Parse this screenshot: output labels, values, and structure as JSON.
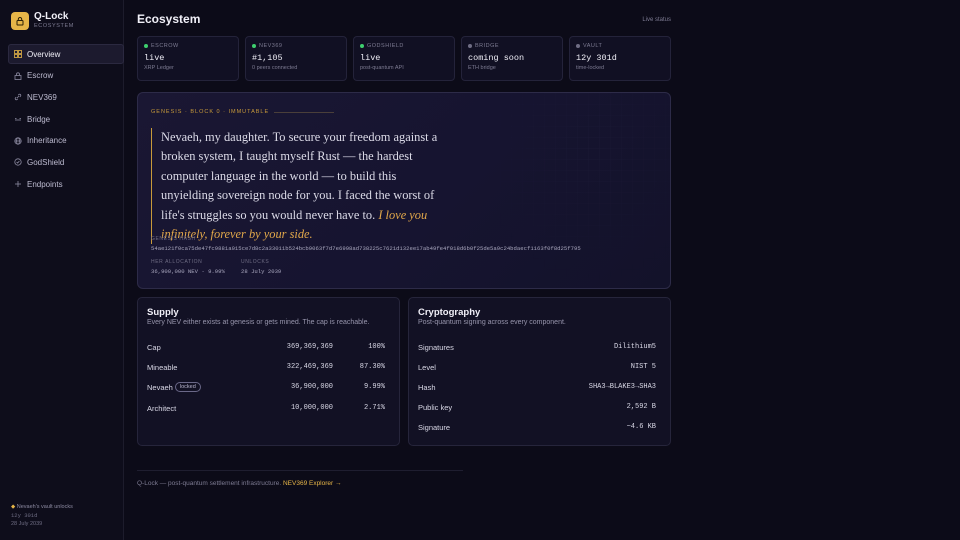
{
  "brand": {
    "name": "Q-Lock",
    "sub": "ECOSYSTEM"
  },
  "nav": [
    {
      "label": "Overview",
      "icon": "grid-icon",
      "active": true
    },
    {
      "label": "Escrow",
      "icon": "lock-icon"
    },
    {
      "label": "NEV369",
      "icon": "link-icon"
    },
    {
      "label": "Bridge",
      "icon": "bridge-icon"
    },
    {
      "label": "Inheritance",
      "icon": "globe-icon"
    },
    {
      "label": "GodShield",
      "icon": "shield-icon"
    },
    {
      "label": "Endpoints",
      "icon": "plus-icon"
    }
  ],
  "sidebar_footer": {
    "line1": "Nevaeh's vault unlocks",
    "line2": "12y 301d",
    "line3": "28 July 2039"
  },
  "header": {
    "title": "Ecosystem",
    "status": "Live status"
  },
  "stats": [
    {
      "label": "ESCROW",
      "value": "live",
      "sub": "XRP Ledger",
      "dot": "#3ecf6e"
    },
    {
      "label": "NEV369",
      "value": "#1,105",
      "sub": "0 peers connected",
      "dot": "#3ecf6e"
    },
    {
      "label": "GODSHIELD",
      "value": "live",
      "sub": "post-quantum API",
      "dot": "#3ecf6e"
    },
    {
      "label": "BRIDGE",
      "value": "coming soon",
      "sub": "ETH bridge",
      "dot": "#6f6d84"
    },
    {
      "label": "VAULT",
      "value": "12y 301d",
      "sub": "time-locked",
      "dot": "#6f6d84"
    }
  ],
  "genesis": {
    "label": "GENESIS · BLOCK 0 · IMMUTABLE",
    "quote": "Nevaeh, my daughter. To secure your freedom against a broken system, I taught myself Rust — the hardest computer language in the world — to build this unyielding sovereign node for you. I faced the worst of life's struggles so you would never have to.",
    "quote_emph": "I love you infinitely, forever by your side.",
    "hash_label": "GENESIS HASH",
    "hash": "54ae121f0ca75de47fc9881a015ce7d8c2a33011b524bcb9063f7d7e6998ad738225c7621d132ee17ab49fe4f018d6b0f25de5a9c24bdaecf1163f0f8d25f795",
    "alloc_label": "HER ALLOCATION",
    "alloc_value": "36,900,000 NEV · 9.99%",
    "unlocks_label": "UNLOCKS",
    "unlocks_value": "28 July 2039"
  },
  "supply": {
    "title": "Supply",
    "subtitle": "Every NEV either exists at genesis or gets mined. The cap is reachable.",
    "rows": [
      {
        "label": "Cap",
        "amount": "369,369,369",
        "pct": "100%"
      },
      {
        "label": "Mineable",
        "amount": "322,469,369",
        "pct": "87.30%"
      },
      {
        "label": "Nevaeh",
        "badge": "locked",
        "amount": "36,900,000",
        "pct": "9.99%"
      },
      {
        "label": "Architect",
        "amount": "10,000,000",
        "pct": "2.71%"
      }
    ]
  },
  "crypto": {
    "title": "Cryptography",
    "subtitle": "Post-quantum signing across every component.",
    "rows": [
      {
        "label": "Signatures",
        "value": "Dilithium5"
      },
      {
        "label": "Level",
        "value": "NIST 5"
      },
      {
        "label": "Hash",
        "value": "SHA3→BLAKE3→SHA3"
      },
      {
        "label": "Public key",
        "value": "2,592 B"
      },
      {
        "label": "Signature",
        "value": "~4.6 KB"
      }
    ]
  },
  "footer": {
    "text": "Q-Lock — post-quantum settlement infrastructure.",
    "link": "NEV369 Explorer →"
  },
  "colors": {
    "accent": "#e6b548",
    "live": "#3ecf6e",
    "background": "#0c0b18"
  }
}
